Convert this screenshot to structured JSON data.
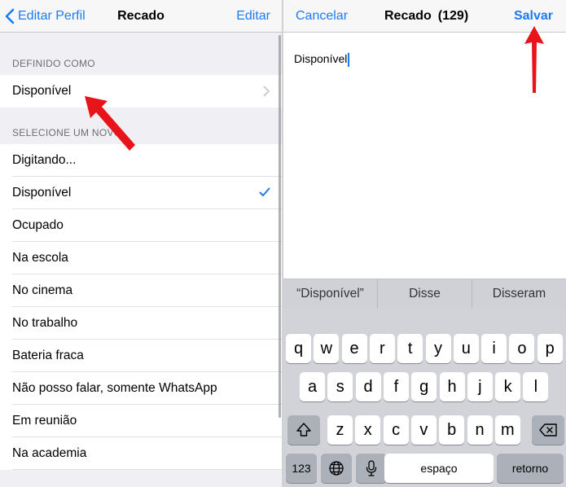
{
  "left_panel": {
    "nav": {
      "back_label": "Editar Perfil",
      "title": "Recado",
      "action_label": "Editar"
    },
    "current_section_header": "DEFINIDO COMO",
    "current_status": "Disponível",
    "choose_section_header": "SELECIONE UM NOVO",
    "options": [
      {
        "label": "Digitando..."
      },
      {
        "label": "Disponível",
        "checked": true
      },
      {
        "label": "Ocupado"
      },
      {
        "label": "Na escola"
      },
      {
        "label": "No cinema"
      },
      {
        "label": "No trabalho"
      },
      {
        "label": "Bateria fraca"
      },
      {
        "label": "Não posso falar, somente WhatsApp"
      },
      {
        "label": "Em reunião"
      },
      {
        "label": "Na academia"
      }
    ]
  },
  "right_panel": {
    "nav": {
      "cancel_label": "Cancelar",
      "title": "Recado",
      "char_count": "(129)",
      "save_label": "Salvar"
    },
    "editor_text": "Disponível",
    "suggestions": [
      "“Disponível”",
      "Disse",
      "Disseram"
    ],
    "keyboard": {
      "row1": [
        "q",
        "w",
        "e",
        "r",
        "t",
        "y",
        "u",
        "i",
        "o",
        "p"
      ],
      "row2": [
        "a",
        "s",
        "d",
        "f",
        "g",
        "h",
        "j",
        "k",
        "l"
      ],
      "row3": [
        "z",
        "x",
        "c",
        "v",
        "b",
        "n",
        "m"
      ],
      "numbers_label": "123",
      "space_label": "espaço",
      "return_label": "retorno"
    }
  },
  "colors": {
    "accent": "#1c7cf4",
    "annotation_arrow": "#e8141a",
    "group_background": "#efeff4"
  }
}
